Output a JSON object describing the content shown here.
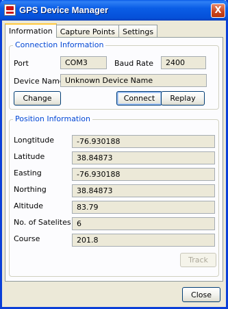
{
  "window": {
    "title": "GPS Device Manager",
    "close_glyph": "X"
  },
  "tabs": [
    {
      "label": "Information"
    },
    {
      "label": "Capture Points"
    },
    {
      "label": "Settings"
    }
  ],
  "connection": {
    "title": "Connection Information",
    "port_label": "Port",
    "port_value": "COM3",
    "baud_label": "Baud Rate",
    "baud_value": "2400",
    "device_label": "Device Name",
    "device_value": "Unknown Device Name",
    "change_button": "Change",
    "connect_button": "Connect",
    "replay_button": "Replay"
  },
  "position": {
    "title": "Position Information",
    "rows": [
      {
        "label": "Longtitude",
        "value": "-76.930188"
      },
      {
        "label": "Latitude",
        "value": "38.84873"
      },
      {
        "label": "Easting",
        "value": "-76.930188"
      },
      {
        "label": "Northing",
        "value": "38.84873"
      },
      {
        "label": "Altitude",
        "value": "83.79"
      },
      {
        "label": "No. of Satelites",
        "value": "6"
      },
      {
        "label": "Course",
        "value": "201.8"
      }
    ],
    "track_button": "Track"
  },
  "footer": {
    "close_button": "Close"
  },
  "colors": {
    "titlebar": "#0a5de6",
    "group_title": "#0046d5",
    "window_bg": "#ece9d8"
  }
}
